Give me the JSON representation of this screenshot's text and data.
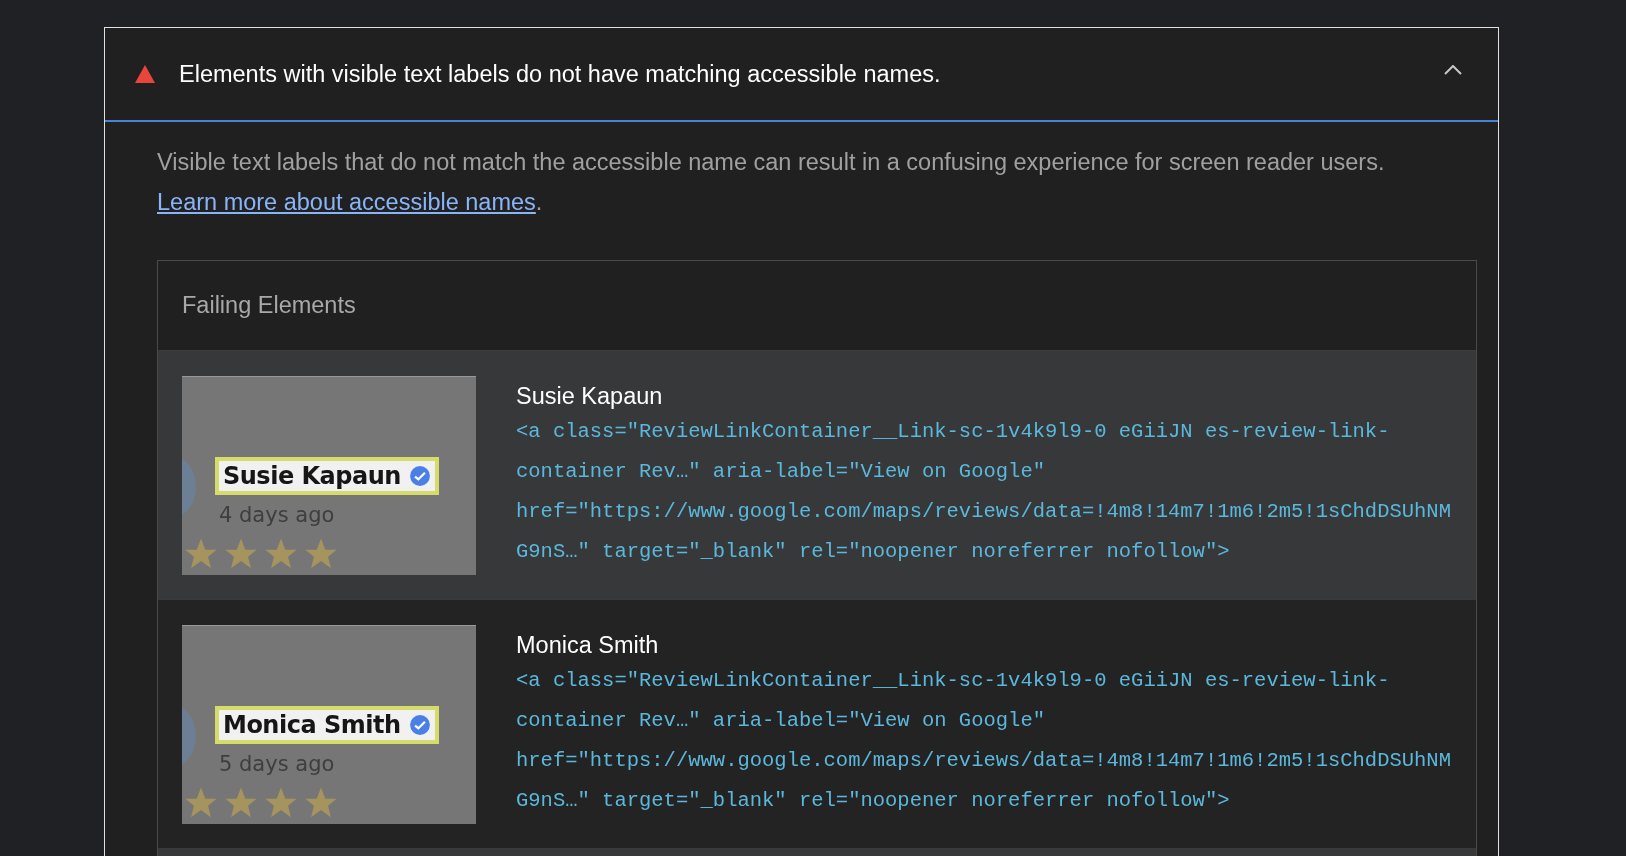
{
  "audit": {
    "title": "Elements with visible text labels do not have matching accessible names.",
    "expanded": true,
    "description": "Visible text labels that do not match the accessible name can result in a confusing experience for screen reader users.",
    "link": "Learn more about accessible names",
    "link_suffix": ".",
    "table": {
      "heading": "Failing Elements",
      "rows": [
        {
          "selected": true,
          "thumb_name": "Susie Kapaun",
          "thumb_time": "4 days ago",
          "stars": 4,
          "label": "Susie Kapaun",
          "code": [
            "<a class=\"ReviewLinkContainer__Link-sc-1v4k9l9-0 eGiiJN es-review-link-",
            "container Rev…\" aria-label=\"View on Google\"",
            "href=\"https://www.google.com/maps/reviews/data=!4m8!14m7!1m6!2m5!1sChdDSUhNM",
            "G9nS…\" target=\"_blank\" rel=\"noopener noreferrer nofollow\">"
          ]
        },
        {
          "selected": false,
          "thumb_name": "Monica Smith",
          "thumb_time": "5 days ago",
          "stars": 4,
          "label": "Monica Smith",
          "code": [
            "<a class=\"ReviewLinkContainer__Link-sc-1v4k9l9-0 eGiiJN es-review-link-",
            "container Rev…\" aria-label=\"View on Google\"",
            "href=\"https://www.google.com/maps/reviews/data=!4m8!14m7!1m6!2m5!1sChdDSUhNM",
            "G9nS…\" target=\"_blank\" rel=\"noopener noreferrer nofollow\">"
          ]
        }
      ]
    }
  }
}
